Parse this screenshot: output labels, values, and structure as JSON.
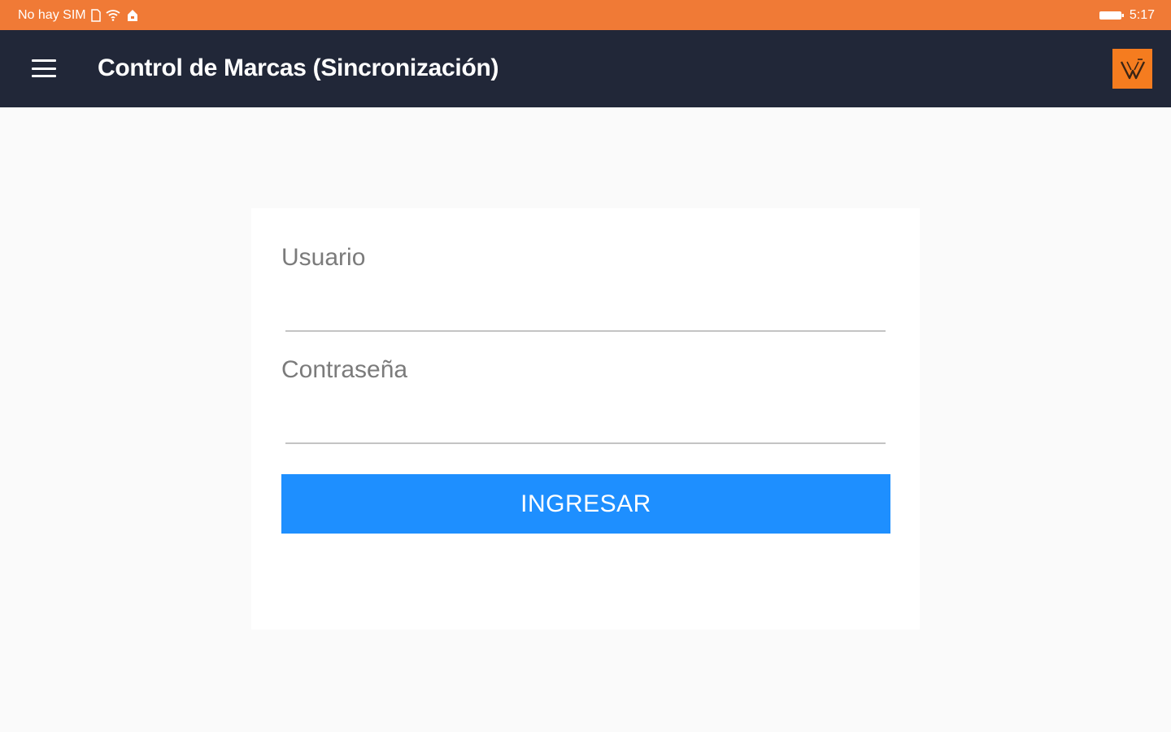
{
  "status_bar": {
    "carrier": "No hay SIM",
    "time": "5:17",
    "background": "#f07a36",
    "icons": [
      "sim-card-icon",
      "wifi-icon",
      "usb-icon",
      "battery-icon"
    ]
  },
  "app_bar": {
    "title": "Control de Marcas (Sincronización)",
    "background": "#212738",
    "menu_icon": "menu-icon",
    "logo_icon": "brand-logo",
    "logo_background": "#f57c1f"
  },
  "login_form": {
    "username_label": "Usuario",
    "username_value": "",
    "password_label": "Contraseña",
    "password_value": "",
    "submit_label": "INGRESAR",
    "submit_color": "#1e8fff"
  }
}
